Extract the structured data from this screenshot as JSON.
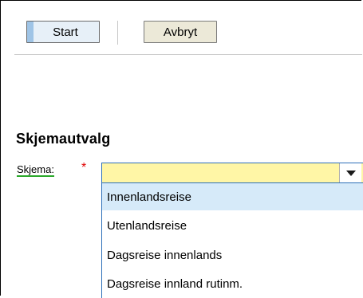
{
  "toolbar": {
    "start_label": "Start",
    "cancel_label": "Avbryt"
  },
  "section": {
    "title": "Skjemautvalg"
  },
  "field": {
    "label": "Skjema:",
    "required_marker": "*",
    "value": ""
  },
  "dropdown": {
    "options": [
      "Innenlandsreise",
      "Utenlandsreise",
      "Dagsreise innenlands",
      "Dagsreise innland rutinm."
    ],
    "highlighted": "Innenlandsreise"
  },
  "colors": {
    "select_background": "#fff6a6",
    "highlight": "#d6eaf9",
    "required": "#e00000",
    "label_underline": "#2aa82a"
  }
}
